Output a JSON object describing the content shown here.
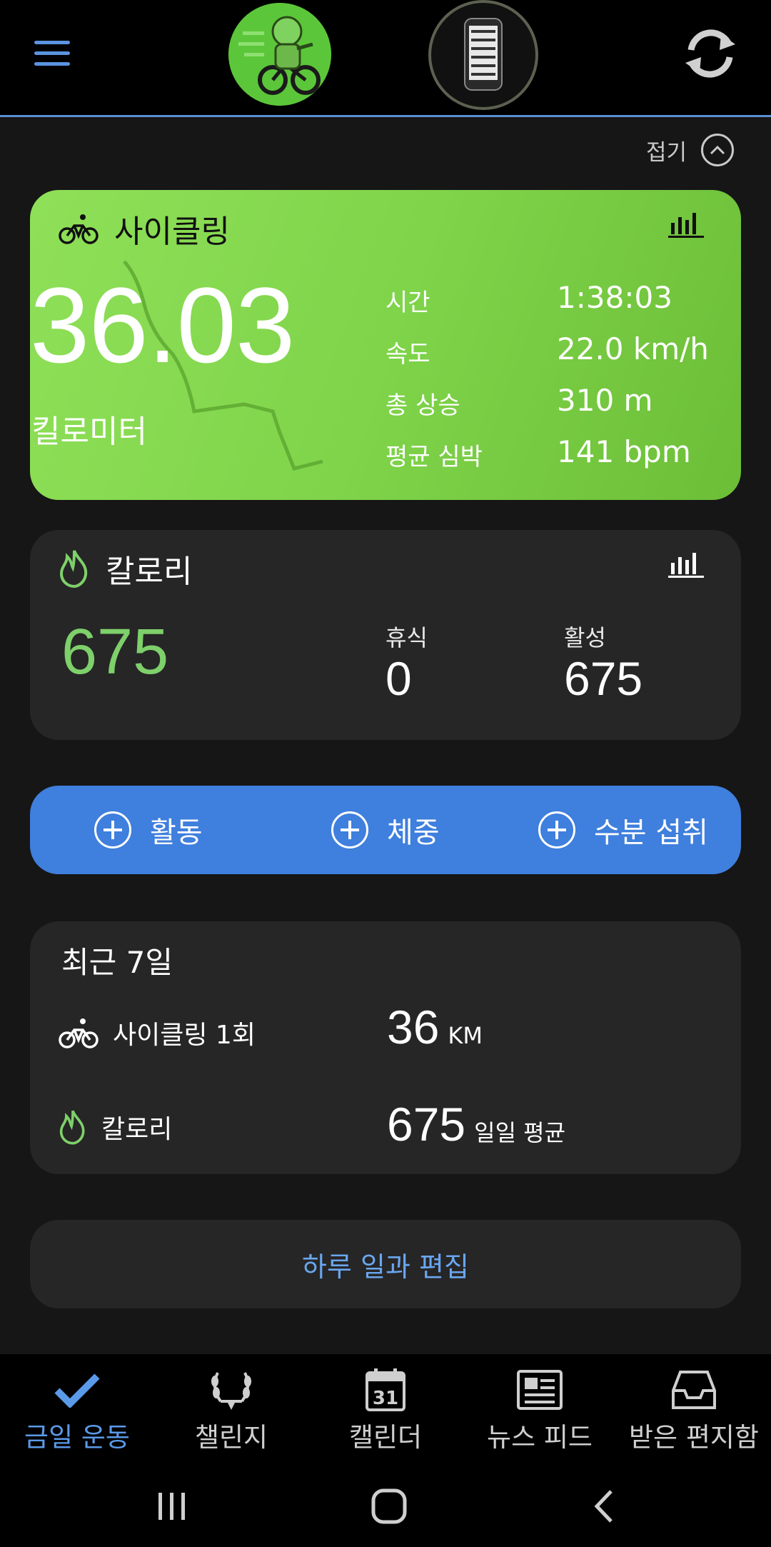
{
  "header": {
    "collapse_label": "접기"
  },
  "cycling": {
    "title": "사이클링",
    "distance": "36.03",
    "distance_unit": "킬로미터",
    "metrics": [
      {
        "label": "시간",
        "value": "1:38:03"
      },
      {
        "label": "속도",
        "value": "22.0 km/h"
      },
      {
        "label": "총 상승",
        "value": "310 m"
      },
      {
        "label": "평균 심박",
        "value": "141 bpm"
      }
    ]
  },
  "calories": {
    "title": "칼로리",
    "total": "675",
    "rest_label": "휴식",
    "rest_value": "0",
    "active_label": "활성",
    "active_value": "675"
  },
  "actions": [
    {
      "label": "활동"
    },
    {
      "label": "체중"
    },
    {
      "label": "수분 섭취"
    }
  ],
  "recent": {
    "title": "최근 7일",
    "rows": [
      {
        "label": "사이클링 1회",
        "value": "36",
        "unit": "KM"
      },
      {
        "label": "칼로리",
        "value": "675",
        "unit": "일일 평균"
      }
    ]
  },
  "edit_label": "하루 일과 편집",
  "bottom_nav": [
    {
      "label": "금일 운동",
      "icon": "checkmark-icon"
    },
    {
      "label": "챌린지",
      "icon": "laurel-icon"
    },
    {
      "label": "캘린더",
      "icon": "calendar-icon"
    },
    {
      "label": "뉴스 피드",
      "icon": "newspaper-icon"
    },
    {
      "label": "받은 편지함",
      "icon": "inbox-icon"
    }
  ],
  "calendar_icon_day": "31",
  "colors": {
    "accent_blue": "#3f7fdd",
    "cycling_green": "#7fd44a",
    "calorie_green": "#7ed06a"
  }
}
